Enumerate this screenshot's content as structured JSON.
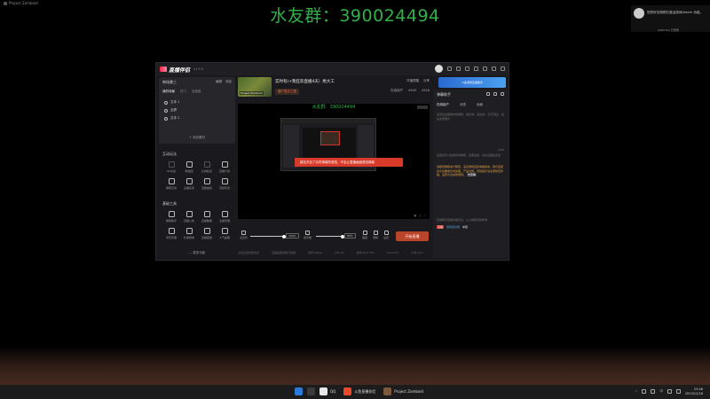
{
  "overlay": {
    "window_title": "Project Zomboid",
    "qq_banner": "水友群：390024494"
  },
  "steam_toast": {
    "message": "您的好友刚刚已激活游戏Steam 功能。",
    "sub": "SAPh Fun 已登录"
  },
  "app": {
    "brand": "直播伴侣",
    "version": "v1.5.5",
    "promo_label": "斗鱼游戏直播助手",
    "left": {
      "scene_title": "带场景三",
      "scene_actions": [
        "编辑",
        "添加"
      ],
      "scene_tabs": [
        "我的场景",
        "热门",
        "百度盘"
      ],
      "sources": [
        "文本 1",
        "全屏",
        "文本 2"
      ],
      "add_source": "+ 添加素材",
      "interactive_title": "互动玩法",
      "interactive_tools": [
        "PK对决",
        "粉丝团",
        "礼物接龙",
        "直播计划",
        "弹幕互动",
        "主播任务",
        "宝箱抽奖",
        "竞猜玩法"
      ],
      "basic_title": "基础工具",
      "basic_tools": [
        "弹幕助手",
        "直播公告",
        "直播数据",
        "主播管理",
        "场景管理",
        "礼物特效",
        "直播回放",
        "人气提醒"
      ],
      "more": "— 更多功能"
    },
    "stream": {
      "cover_tag": "Project Zomboid",
      "title": "实时有(+我狂欢直播4天）绝大工",
      "category": "僵尸毁灭工程",
      "actions": [
        "开播提醒",
        "分享"
      ],
      "stats": [
        "在线用户",
        "4949",
        "4326"
      ]
    },
    "preview": {
      "watermark": "水友群：390024494",
      "toast": "建议开启了实时弹幕防遮挡，不会让直播画面遮挡弹幕"
    },
    "controls": {
      "mic_label": "麦克风",
      "mic_pct": "100%",
      "speaker_label": "扬声器",
      "speaker_pct": "80%",
      "extra": [
        "美颜",
        "录制",
        "设置"
      ],
      "go_live": "开始直播"
    },
    "statusbar": [
      "点击设置性能优化",
      "直播画面质量已就绪",
      "码率:0Kbps",
      "FPS:60",
      "帧率:60.0 FPS",
      "CPU:20%",
      "内存:40%",
      "24:04"
    ],
    "right": {
      "head": "弹幕助手",
      "tabs": [
        "在线用户",
        "消息",
        "贡献"
      ],
      "hint_top": "设置后主播发布的弹幕、送礼物、关注的... 打赏消息，会在这里展示",
      "counter": "0/64",
      "hint_mid": "设置后可以接收实时弹幕，如需设置，请在直播后点击",
      "notice": "请规范弹幕言行规范，违反规则直接举报禁言，我们会配合平台要求及时处理，产品合规，风险提示请注意防范诈骗，设置平台最新规则。",
      "notice_link": "去查看",
      "foot": "该弹幕与直播内容无关，以上弹幕仅供参考",
      "foot_badge": "直播",
      "foot_user": "游戏爱好者",
      "foot_action": "举报"
    }
  },
  "taskbar": {
    "apps": [
      "QQ",
      "斗鱼直播伴侣",
      "Project Zomboid"
    ],
    "clock_time": "23:46",
    "clock_date": "2023/12/16",
    "lang": "中"
  }
}
